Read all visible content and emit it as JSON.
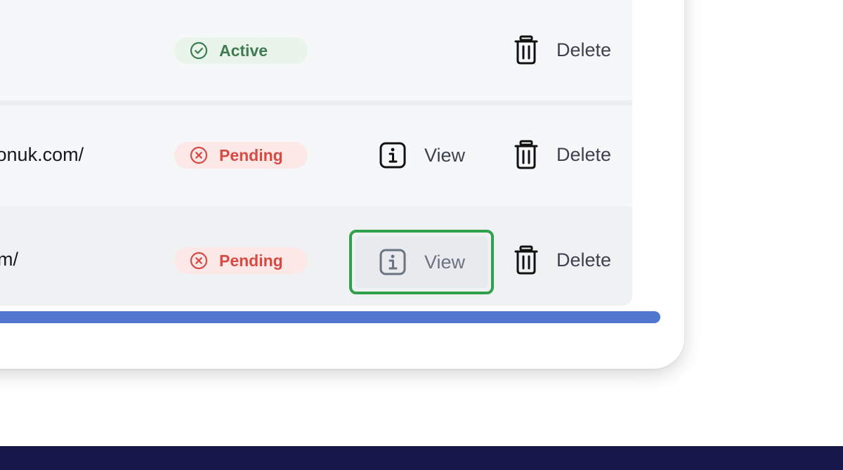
{
  "rows": [
    {
      "url": "",
      "status": "Active",
      "status_type": "active",
      "view_label": "",
      "delete_label": "Delete"
    },
    {
      "url": "shionuk.com/",
      "status": "Pending",
      "status_type": "pending",
      "view_label": "View",
      "delete_label": "Delete"
    },
    {
      "url": ".com/",
      "status": "Pending",
      "status_type": "pending",
      "view_label": "View",
      "delete_label": "Delete"
    }
  ],
  "icons": {
    "active": "check-circle-icon",
    "pending": "x-circle-icon",
    "view": "info-square-icon",
    "delete": "trash-icon"
  },
  "colors": {
    "active_text": "#3f7b51",
    "active_bg": "#e9f4ea",
    "pending_text": "#d64a43",
    "pending_bg": "#fce8e7",
    "focus_ring": "#30a04a",
    "scrollbar": "#5076cd",
    "footer": "#17184a"
  }
}
